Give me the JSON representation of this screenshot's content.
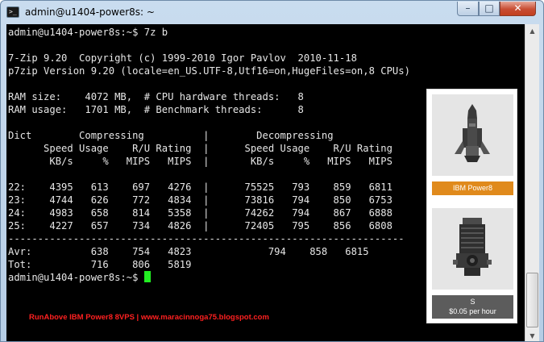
{
  "window": {
    "title": "admin@u1404-power8s: ~",
    "controls": {
      "minimize": "–",
      "maximize": "□",
      "close": "✕"
    }
  },
  "terminal": {
    "lines": [
      "admin@u1404-power8s:~$ 7z b",
      "",
      "7-Zip 9.20  Copyright (c) 1999-2010 Igor Pavlov  2010-11-18",
      "p7zip Version 9.20 (locale=en_US.UTF-8,Utf16=on,HugeFiles=on,8 CPUs)",
      "",
      "RAM size:    4072 MB,  # CPU hardware threads:   8",
      "RAM usage:   1701 MB,  # Benchmark threads:      8",
      "",
      "Dict        Compressing          |        Decompressing",
      "      Speed Usage    R/U Rating  |      Speed Usage    R/U Rating",
      "       KB/s     %   MIPS   MIPS  |       KB/s     %   MIPS   MIPS",
      "",
      "22:    4395   613    697   4276  |      75525   793    859   6811",
      "23:    4744   626    772   4834  |      73816   794    850   6753",
      "24:    4983   658    814   5358  |      74262   794    867   6888",
      "25:    4227   657    734   4826  |      72405   795    856   6808",
      "-------------------------------------------------------------------",
      "Avr:          638    754   4823             794    858   6815",
      "Tot:          716    806   5819",
      "admin@u1404-power8s:~$ "
    ],
    "cursor_color": "#22ee22"
  },
  "watermark": "RunAbove IBM Power8 8VPS | www.maracinnoga75.blogspot.com",
  "ad": {
    "badge1": "IBM Power8",
    "badge2_line1": "S",
    "badge2_line2": "$0.05 per hour",
    "badge1_color": "#e08a1c",
    "badge2_color": "#5c5c5c",
    "icons": [
      "rocket-icon",
      "engine-icon"
    ]
  },
  "scrollbar": {
    "up_arrow": "▲",
    "down_arrow": "▼"
  }
}
